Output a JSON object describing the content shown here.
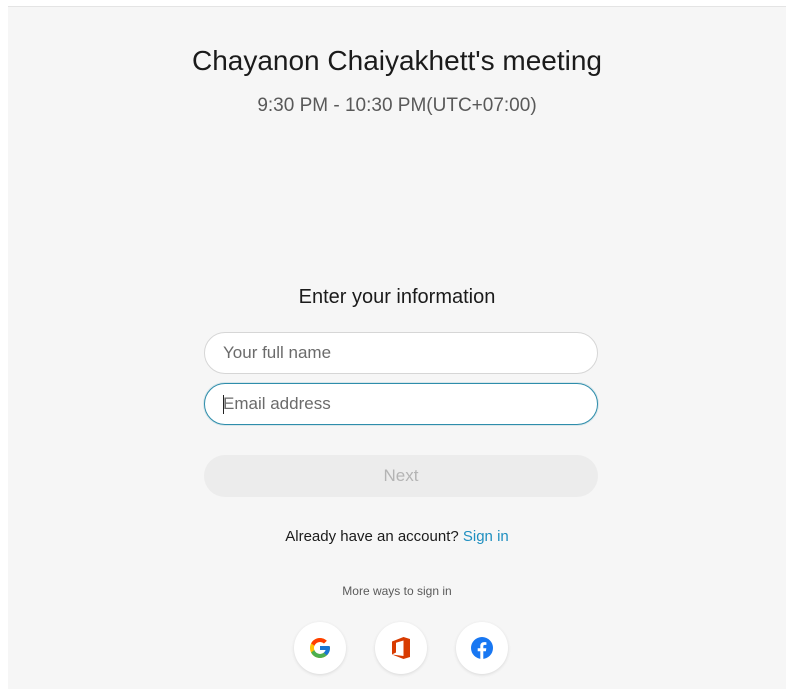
{
  "meeting": {
    "title": "Chayanon Chaiyakhett's meeting",
    "time": "9:30 PM - 10:30 PM(UTC+07:00)"
  },
  "form": {
    "heading": "Enter your information",
    "name_placeholder": "Your full name",
    "email_placeholder": "Email address",
    "next_label": "Next"
  },
  "account": {
    "prompt": "Already have an account?",
    "signin_label": "Sign in"
  },
  "more_ways": {
    "label": "More ways to sign in",
    "providers": [
      {
        "icon": "google-icon",
        "color": "#4285F4"
      },
      {
        "icon": "office-icon",
        "color": "#D83B01"
      },
      {
        "icon": "facebook-icon",
        "color": "#1877F2"
      }
    ]
  },
  "colors": {
    "accent": "#1e8fc0",
    "focus_border": "#2e8dab",
    "panel_bg": "#f6f6f6"
  }
}
